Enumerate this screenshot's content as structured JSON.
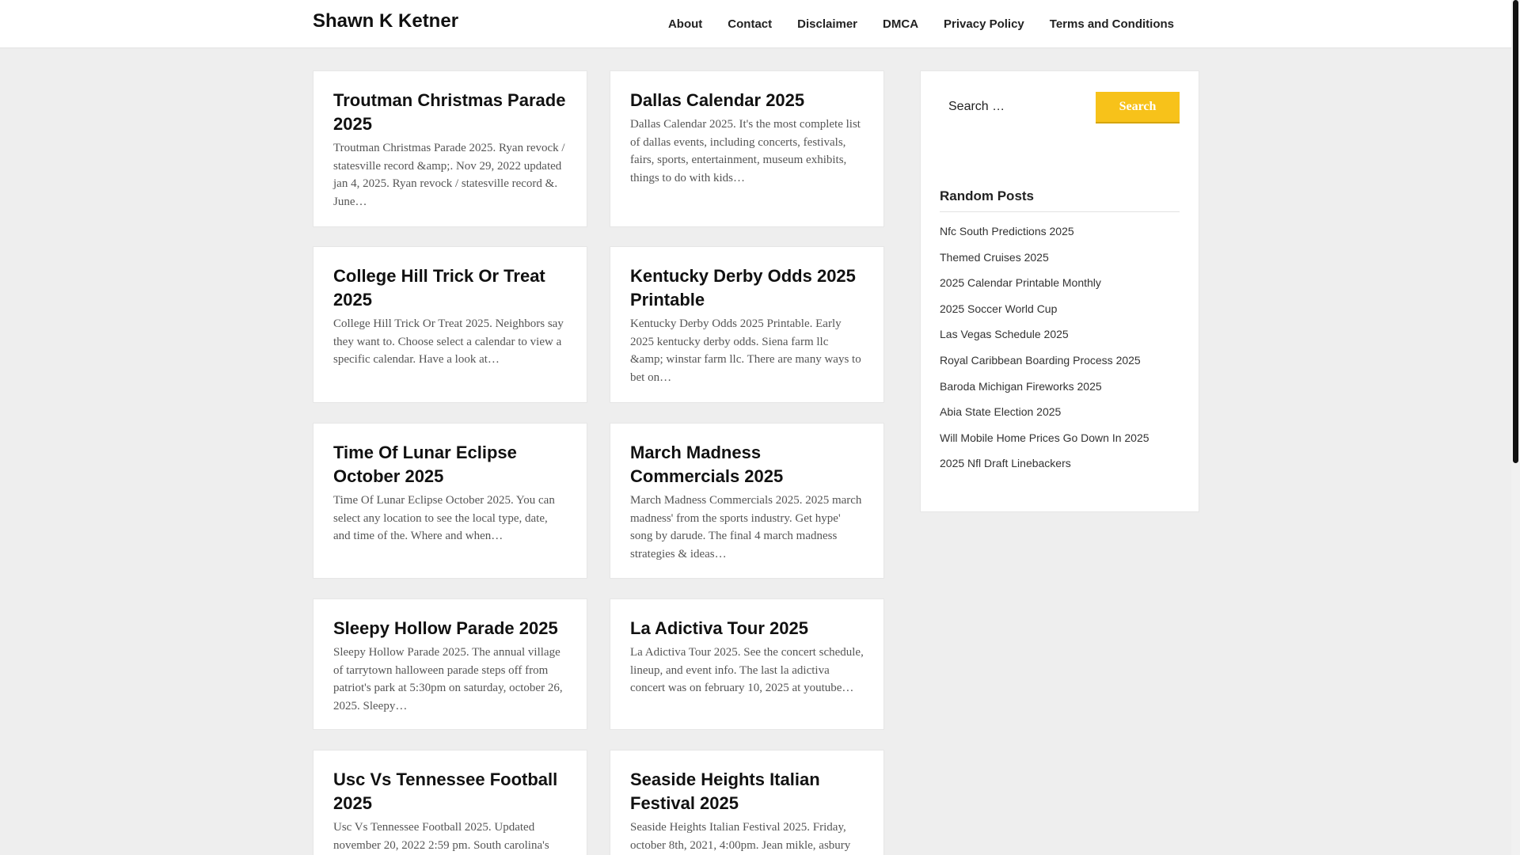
{
  "header": {
    "site_title": "Shawn K Ketner",
    "nav": [
      "About",
      "Contact",
      "Disclaimer",
      "DMCA",
      "Privacy Policy",
      "Terms and Conditions"
    ]
  },
  "posts": [
    {
      "title": "Troutman Christmas Parade 2025",
      "excerpt": "Troutman Christmas Parade 2025. Ryan revock / statesville record &amp;. Nov 29, 2022 updated jan 4, 2025. Ryan revock / statesville record &. June…"
    },
    {
      "title": "Dallas Calendar 2025",
      "excerpt": "Dallas Calendar 2025. It's the most complete list of dallas events, including concerts, festivals, fairs, sports, entertainment, museum exhibits, things to do with kids…"
    },
    {
      "title": "College Hill Trick Or Treat 2025",
      "excerpt": "College Hill Trick Or Treat 2025. Neighbors say they want to. Choose select a calendar to view a specific calendar. Have a look at…"
    },
    {
      "title": "Kentucky Derby Odds 2025 Printable",
      "excerpt": "Kentucky Derby Odds 2025 Printable. Early 2025 kentucky derby odds. Siena farm llc &amp; winstar farm llc. There are many ways to bet on…"
    },
    {
      "title": "Time Of Lunar Eclipse October 2025",
      "excerpt": "Time Of Lunar Eclipse October 2025. You can select any location to see the local type, date, and time of the. Where and when…"
    },
    {
      "title": "March Madness Commercials 2025",
      "excerpt": "March Madness Commercials 2025. 2025 march madness' from the sports industry. Get hype' song by darude. The final 4 march madness strategies & ideas…"
    },
    {
      "title": "Sleepy Hollow Parade 2025",
      "excerpt": "Sleepy Hollow Parade 2025. The annual village of tarrytown halloween parade steps off from patriot's park at 5:30pm on saturday, october 26, 2025. Sleepy…"
    },
    {
      "title": "La Adictiva Tour 2025",
      "excerpt": "La Adictiva Tour 2025. See the concert schedule, lineup, and event info. The last la adictiva concert was on february 10, 2025 at youtube…"
    },
    {
      "title": "Usc Vs Tennessee Football 2025",
      "excerpt": "Usc Vs Tennessee Football 2025. Updated november 20, 2022 2:59 pm. South carolina's"
    },
    {
      "title": "Seaside Heights Italian Festival 2025",
      "excerpt": "Seaside Heights Italian Festival 2025. Friday, october 8th, 2021, 4:00pm. Jean mikle, asbury"
    }
  ],
  "sidebar": {
    "search_placeholder": "Search …",
    "search_button": "Search",
    "random_posts_title": "Random Posts",
    "random_posts": [
      "Nfc South Predictions 2025",
      "Themed Cruises 2025",
      "2025 Calendar Printable Monthly",
      "2025 Soccer World Cup",
      "Las Vegas Schedule 2025",
      "Royal Caribbean Boarding Process 2025",
      "Baroda Michigan Fireworks 2025",
      "Abia State Election 2025",
      "Will Mobile Home Prices Go Down In 2025",
      "2025 Nfl Draft Linebackers"
    ]
  }
}
